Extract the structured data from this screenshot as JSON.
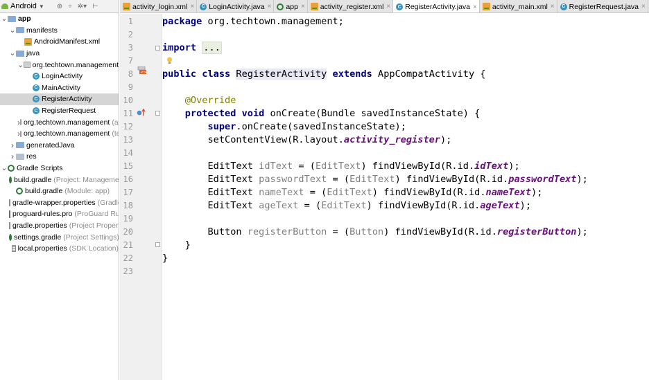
{
  "project_panel": {
    "view": "Android",
    "tree": [
      {
        "label": "app",
        "indent": 0,
        "arrow": "down",
        "icon": "folder-module",
        "bold": true
      },
      {
        "label": "manifests",
        "indent": 1,
        "arrow": "down",
        "icon": "folder-blue"
      },
      {
        "label": "AndroidManifest.xml",
        "indent": 2,
        "arrow": "",
        "icon": "xml"
      },
      {
        "label": "java",
        "indent": 1,
        "arrow": "down",
        "icon": "folder-blue"
      },
      {
        "label": "org.techtown.management",
        "indent": 2,
        "arrow": "down",
        "icon": "package"
      },
      {
        "label": "LoginActivity",
        "indent": 3,
        "arrow": "",
        "icon": "class"
      },
      {
        "label": "MainActivity",
        "indent": 3,
        "arrow": "",
        "icon": "class"
      },
      {
        "label": "RegisterActivity",
        "indent": 3,
        "arrow": "",
        "icon": "class",
        "selected": true
      },
      {
        "label": "RegisterRequest",
        "indent": 3,
        "arrow": "",
        "icon": "class"
      },
      {
        "label": "org.techtown.management",
        "indent": 2,
        "arrow": "right",
        "icon": "package",
        "hint": "(androidTest)"
      },
      {
        "label": "org.techtown.management",
        "indent": 2,
        "arrow": "right",
        "icon": "package",
        "hint": "(test)"
      },
      {
        "label": "generatedJava",
        "indent": 1,
        "arrow": "right",
        "icon": "folder-blue"
      },
      {
        "label": "res",
        "indent": 1,
        "arrow": "right",
        "icon": "folder-grey"
      },
      {
        "label": "Gradle Scripts",
        "indent": 0,
        "arrow": "down",
        "icon": "gradle"
      },
      {
        "label": "build.gradle",
        "indent": 1,
        "arrow": "",
        "icon": "gradle",
        "hint": "(Project: Management)"
      },
      {
        "label": "build.gradle",
        "indent": 1,
        "arrow": "",
        "icon": "gradle",
        "hint": "(Module: app)"
      },
      {
        "label": "gradle-wrapper.properties",
        "indent": 1,
        "arrow": "",
        "icon": "properties",
        "hint": "(Gradle Version)"
      },
      {
        "label": "proguard-rules.pro",
        "indent": 1,
        "arrow": "",
        "icon": "pro",
        "hint": "(ProGuard Rules)"
      },
      {
        "label": "gradle.properties",
        "indent": 1,
        "arrow": "",
        "icon": "properties",
        "hint": "(Project Properties)"
      },
      {
        "label": "settings.gradle",
        "indent": 1,
        "arrow": "",
        "icon": "gradle",
        "hint": "(Project Settings)"
      },
      {
        "label": "local.properties",
        "indent": 1,
        "arrow": "",
        "icon": "properties",
        "hint": "(SDK Location)"
      }
    ]
  },
  "tabs": [
    {
      "label": "activity_login.xml",
      "icon": "xml"
    },
    {
      "label": "LoginActivity.java",
      "icon": "class"
    },
    {
      "label": "app",
      "icon": "gradle"
    },
    {
      "label": "activity_register.xml",
      "icon": "xml"
    },
    {
      "label": "RegisterActivity.java",
      "icon": "class",
      "active": true
    },
    {
      "label": "activity_main.xml",
      "icon": "xml"
    },
    {
      "label": "RegisterRequest.java",
      "icon": "class"
    },
    {
      "label": "",
      "icon": "xml"
    }
  ],
  "editor": {
    "line_numbers": [
      "1",
      "2",
      "3",
      "7",
      "8",
      "9",
      "10",
      "11",
      "12",
      "13",
      "14",
      "15",
      "16",
      "17",
      "18",
      "19",
      "20",
      "21",
      "22",
      "23"
    ],
    "lines": [
      [
        {
          "t": "package ",
          "c": "kw"
        },
        {
          "t": "org.techtown.management;",
          "c": ""
        }
      ],
      [],
      [
        {
          "t": "import ",
          "c": "kw"
        },
        {
          "t": "...",
          "c": "fold"
        }
      ],
      [],
      [
        {
          "t": "public class ",
          "c": "kw"
        },
        {
          "t": "RegisterActivity",
          "c": "hl"
        },
        {
          "t": " ",
          "c": ""
        },
        {
          "t": "extends ",
          "c": "kw"
        },
        {
          "t": "AppCompatActivity {",
          "c": ""
        }
      ],
      [],
      [
        {
          "t": "    ",
          "c": ""
        },
        {
          "t": "@Override",
          "c": "ann"
        }
      ],
      [
        {
          "t": "    ",
          "c": ""
        },
        {
          "t": "protected void ",
          "c": "kw"
        },
        {
          "t": "onCreate(Bundle savedInstanceState) {",
          "c": ""
        }
      ],
      [
        {
          "t": "        ",
          "c": ""
        },
        {
          "t": "super",
          "c": "kw"
        },
        {
          "t": ".onCreate(savedInstanceState);",
          "c": ""
        }
      ],
      [
        {
          "t": "        setContentView(R.layout.",
          "c": ""
        },
        {
          "t": "activity_register",
          "c": "fld"
        },
        {
          "t": ");",
          "c": ""
        }
      ],
      [],
      [
        {
          "t": "        EditText ",
          "c": ""
        },
        {
          "t": "idText",
          "c": "unused"
        },
        {
          "t": " = (",
          "c": ""
        },
        {
          "t": "EditText",
          "c": "cast"
        },
        {
          "t": ") findViewById(R.id.",
          "c": ""
        },
        {
          "t": "idText",
          "c": "fld"
        },
        {
          "t": ");",
          "c": ""
        }
      ],
      [
        {
          "t": "        EditText ",
          "c": ""
        },
        {
          "t": "passwordText",
          "c": "unused"
        },
        {
          "t": " = (",
          "c": ""
        },
        {
          "t": "EditText",
          "c": "cast"
        },
        {
          "t": ") findViewById(R.id.",
          "c": ""
        },
        {
          "t": "passwordText",
          "c": "fld"
        },
        {
          "t": ");",
          "c": ""
        }
      ],
      [
        {
          "t": "        EditText ",
          "c": ""
        },
        {
          "t": "nameText",
          "c": "unused"
        },
        {
          "t": " = (",
          "c": ""
        },
        {
          "t": "EditText",
          "c": "cast"
        },
        {
          "t": ") findViewById(R.id.",
          "c": ""
        },
        {
          "t": "nameText",
          "c": "fld"
        },
        {
          "t": ");",
          "c": ""
        }
      ],
      [
        {
          "t": "        EditText ",
          "c": ""
        },
        {
          "t": "ageText",
          "c": "unused"
        },
        {
          "t": " = (",
          "c": ""
        },
        {
          "t": "EditText",
          "c": "cast"
        },
        {
          "t": ") findViewById(R.id.",
          "c": ""
        },
        {
          "t": "ageText",
          "c": "fld"
        },
        {
          "t": ");",
          "c": ""
        }
      ],
      [],
      [
        {
          "t": "        Button ",
          "c": ""
        },
        {
          "t": "registerButton",
          "c": "unused"
        },
        {
          "t": " = (",
          "c": ""
        },
        {
          "t": "Button",
          "c": "cast"
        },
        {
          "t": ") findViewById(R.id.",
          "c": ""
        },
        {
          "t": "registerButton",
          "c": "fld"
        },
        {
          "t": ");",
          "c": ""
        }
      ],
      [
        {
          "t": "    }",
          "c": ""
        }
      ],
      [
        {
          "t": "}",
          "c": ""
        }
      ],
      []
    ]
  }
}
